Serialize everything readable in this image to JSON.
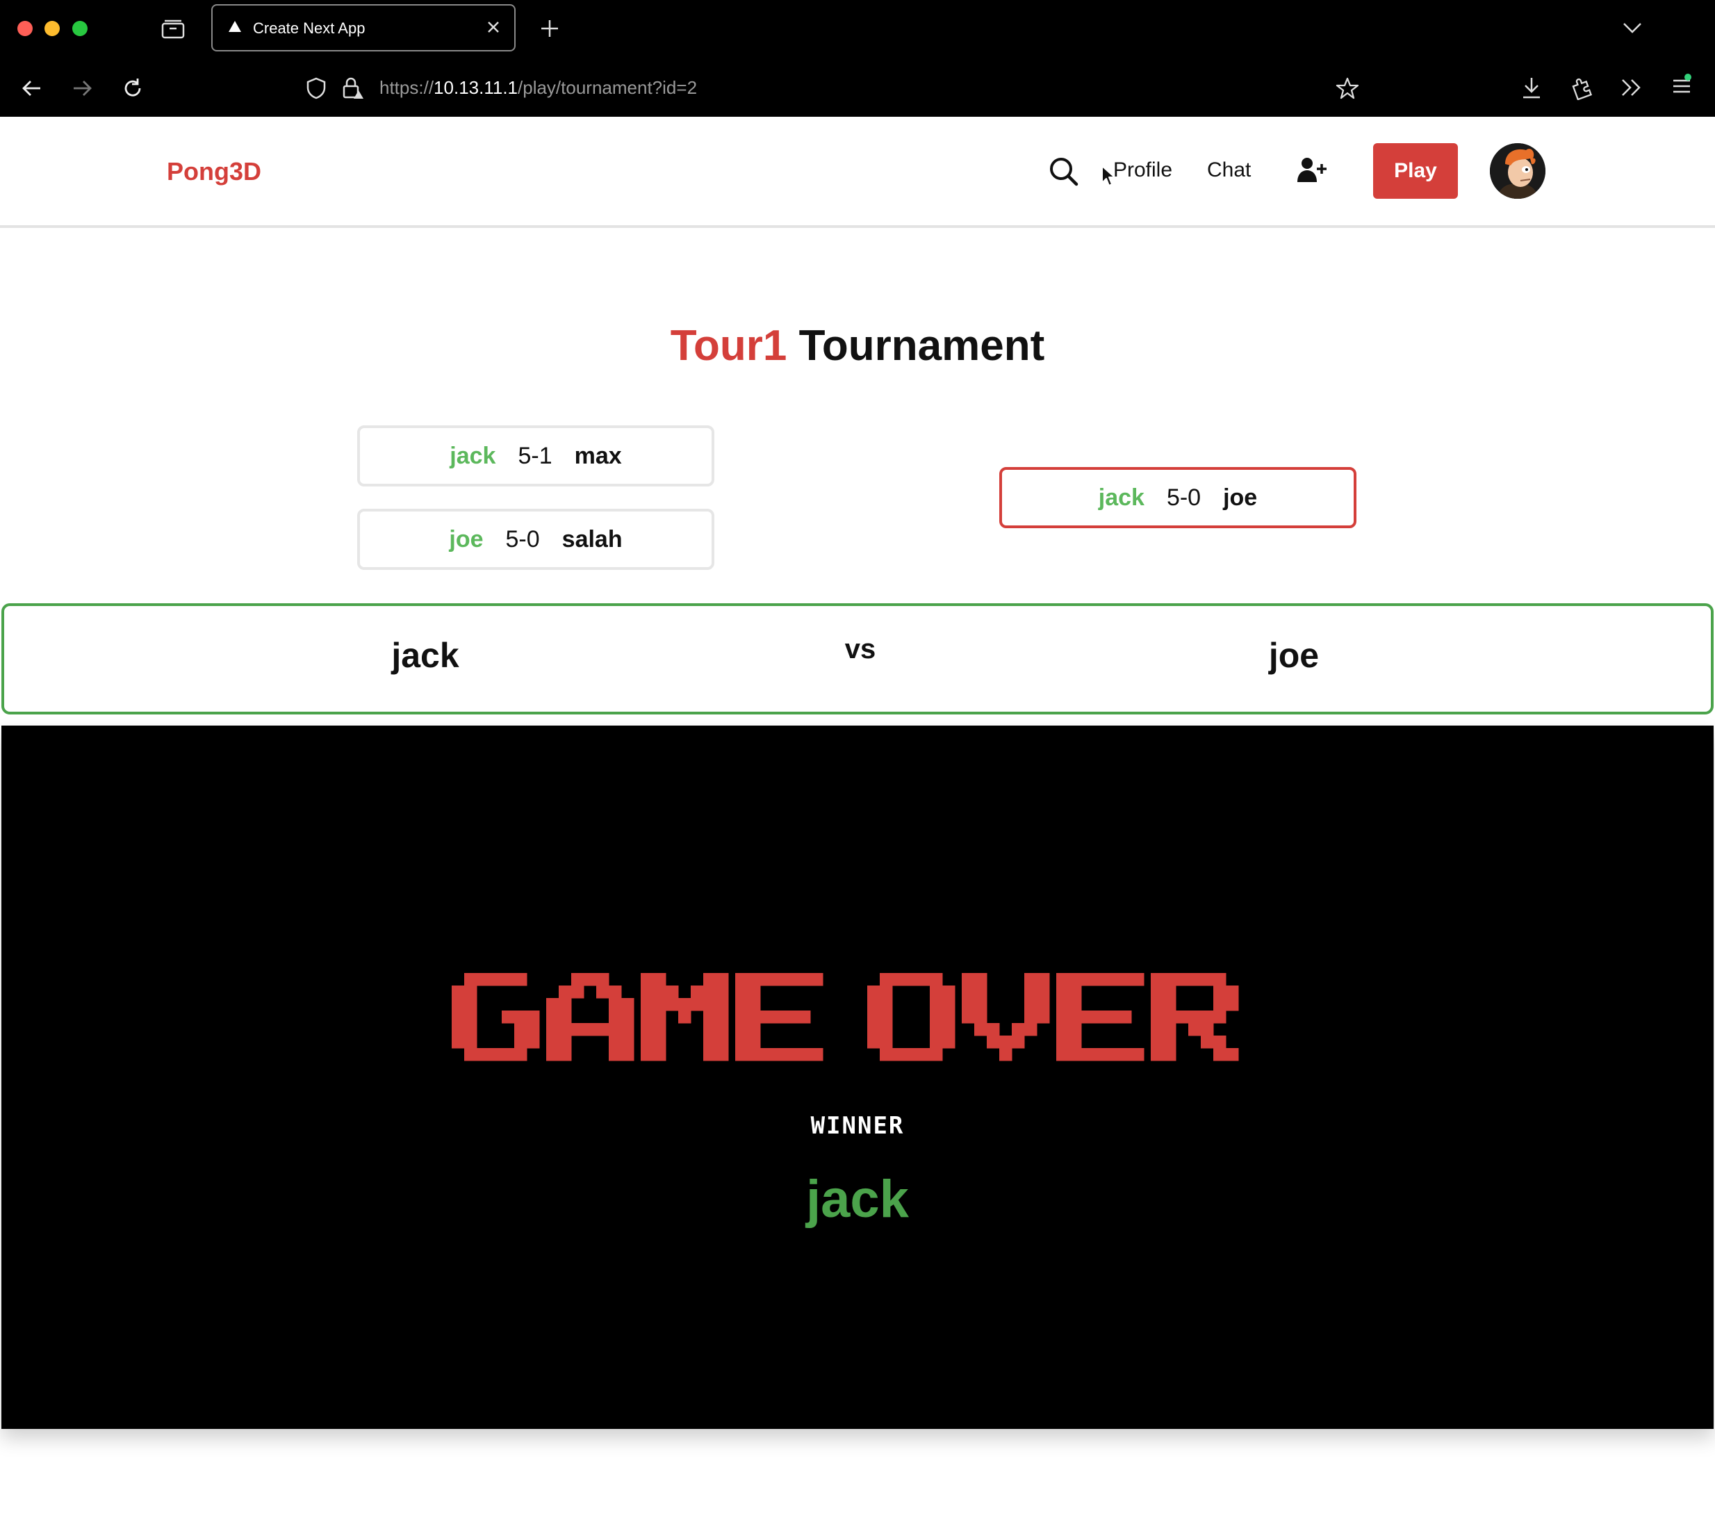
{
  "browser": {
    "tab_title": "Create Next App",
    "url_prefix": "https://",
    "url_host": "10.13.11.1",
    "url_path": "/play/tournament?id=2"
  },
  "header": {
    "logo": "Pong3D",
    "nav": {
      "profile": "Profile",
      "chat": "Chat"
    },
    "play_label": "Play"
  },
  "tournament": {
    "name": "Tour1",
    "title_suffix": "Tournament",
    "round1": [
      {
        "winner": "jack",
        "score": "5-1",
        "loser": "max"
      },
      {
        "winner": "joe",
        "score": "5-0",
        "loser": "salah"
      }
    ],
    "final": {
      "winner": "jack",
      "score": "5-0",
      "loser": "joe"
    }
  },
  "versus": {
    "player1": "jack",
    "label": "vs",
    "player2": "joe"
  },
  "game": {
    "headline": "GAME OVER",
    "winner_label": "WINNER",
    "winner_name": "jack"
  },
  "colors": {
    "accent_red": "#d43f3a",
    "win_green": "#5cb85c",
    "versus_border": "#4ba34b"
  },
  "icons": [
    "tab-group-icon",
    "next-favicon-icon",
    "close-icon",
    "plus-icon",
    "chevron-down-icon",
    "back-arrow-icon",
    "forward-arrow-icon",
    "reload-icon",
    "shield-icon",
    "lock-icon",
    "star-icon",
    "download-icon",
    "extensions-icon",
    "more-tools-icon",
    "menu-icon",
    "search-icon",
    "add-user-icon"
  ]
}
